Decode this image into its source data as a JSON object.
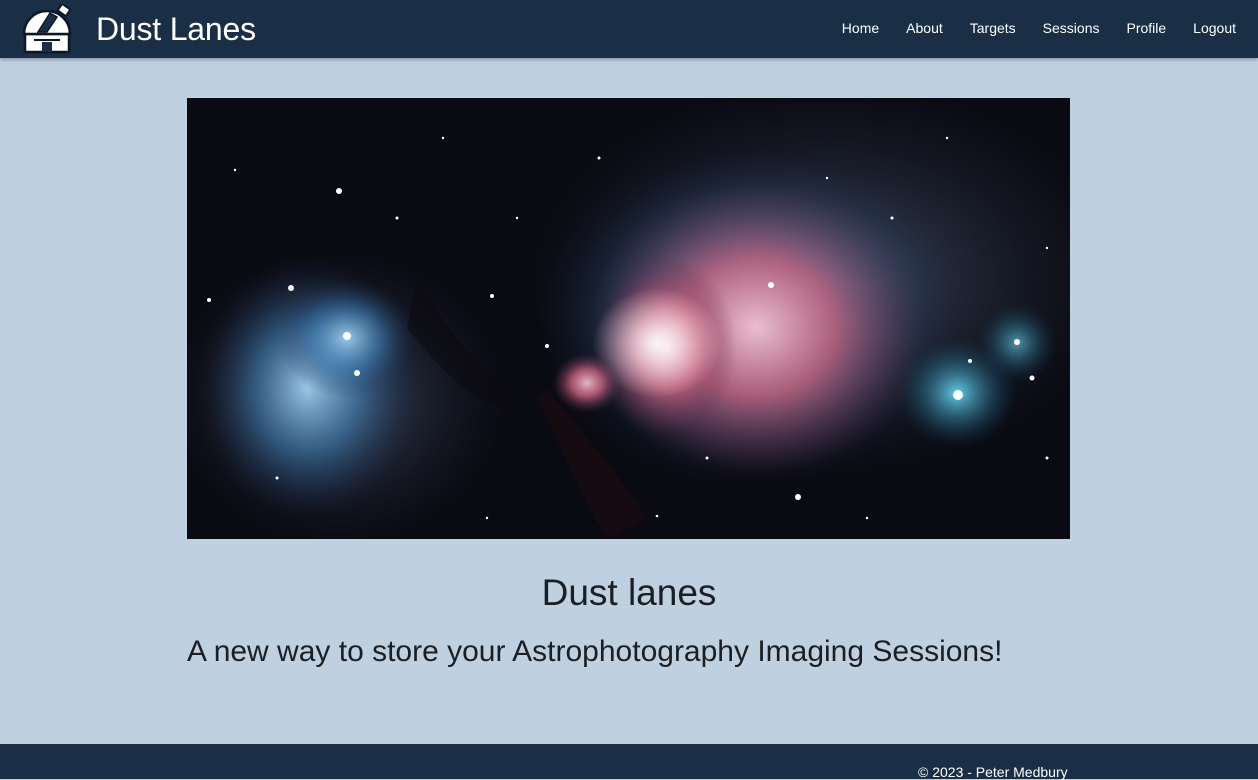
{
  "brand": {
    "logo_icon": "observatory-dome-icon",
    "name": "Dust Lanes"
  },
  "nav": {
    "items": [
      {
        "label": "Home"
      },
      {
        "label": "About"
      },
      {
        "label": "Targets"
      },
      {
        "label": "Sessions"
      },
      {
        "label": "Profile"
      },
      {
        "label": "Logout"
      }
    ]
  },
  "hero": {
    "image": "orion-nebula-photo"
  },
  "main": {
    "title": "Dust lanes",
    "tagline": "A new way to store your Astrophotography Imaging Sessions!"
  },
  "footer": {
    "copyright": "© 2023 - Peter Medbury"
  },
  "colors": {
    "navbar": "#1a2e46",
    "page_background": "#bfd0e1",
    "text": "#1b1f24",
    "nav_text": "#ffffff"
  }
}
